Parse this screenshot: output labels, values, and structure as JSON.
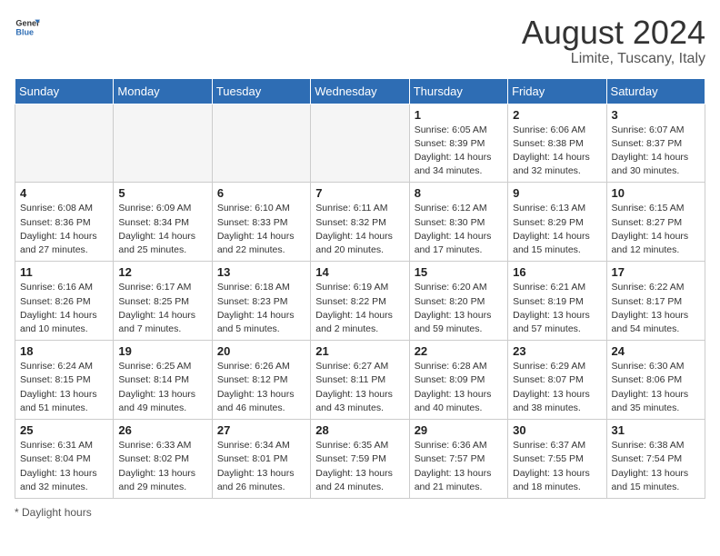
{
  "header": {
    "logo_general": "General",
    "logo_blue": "Blue",
    "main_title": "August 2024",
    "subtitle": "Limite, Tuscany, Italy"
  },
  "weekdays": [
    "Sunday",
    "Monday",
    "Tuesday",
    "Wednesday",
    "Thursday",
    "Friday",
    "Saturday"
  ],
  "weeks": [
    [
      {
        "day": "",
        "info": ""
      },
      {
        "day": "",
        "info": ""
      },
      {
        "day": "",
        "info": ""
      },
      {
        "day": "",
        "info": ""
      },
      {
        "day": "1",
        "info": "Sunrise: 6:05 AM\nSunset: 8:39 PM\nDaylight: 14 hours and 34 minutes."
      },
      {
        "day": "2",
        "info": "Sunrise: 6:06 AM\nSunset: 8:38 PM\nDaylight: 14 hours and 32 minutes."
      },
      {
        "day": "3",
        "info": "Sunrise: 6:07 AM\nSunset: 8:37 PM\nDaylight: 14 hours and 30 minutes."
      }
    ],
    [
      {
        "day": "4",
        "info": "Sunrise: 6:08 AM\nSunset: 8:36 PM\nDaylight: 14 hours and 27 minutes."
      },
      {
        "day": "5",
        "info": "Sunrise: 6:09 AM\nSunset: 8:34 PM\nDaylight: 14 hours and 25 minutes."
      },
      {
        "day": "6",
        "info": "Sunrise: 6:10 AM\nSunset: 8:33 PM\nDaylight: 14 hours and 22 minutes."
      },
      {
        "day": "7",
        "info": "Sunrise: 6:11 AM\nSunset: 8:32 PM\nDaylight: 14 hours and 20 minutes."
      },
      {
        "day": "8",
        "info": "Sunrise: 6:12 AM\nSunset: 8:30 PM\nDaylight: 14 hours and 17 minutes."
      },
      {
        "day": "9",
        "info": "Sunrise: 6:13 AM\nSunset: 8:29 PM\nDaylight: 14 hours and 15 minutes."
      },
      {
        "day": "10",
        "info": "Sunrise: 6:15 AM\nSunset: 8:27 PM\nDaylight: 14 hours and 12 minutes."
      }
    ],
    [
      {
        "day": "11",
        "info": "Sunrise: 6:16 AM\nSunset: 8:26 PM\nDaylight: 14 hours and 10 minutes."
      },
      {
        "day": "12",
        "info": "Sunrise: 6:17 AM\nSunset: 8:25 PM\nDaylight: 14 hours and 7 minutes."
      },
      {
        "day": "13",
        "info": "Sunrise: 6:18 AM\nSunset: 8:23 PM\nDaylight: 14 hours and 5 minutes."
      },
      {
        "day": "14",
        "info": "Sunrise: 6:19 AM\nSunset: 8:22 PM\nDaylight: 14 hours and 2 minutes."
      },
      {
        "day": "15",
        "info": "Sunrise: 6:20 AM\nSunset: 8:20 PM\nDaylight: 13 hours and 59 minutes."
      },
      {
        "day": "16",
        "info": "Sunrise: 6:21 AM\nSunset: 8:19 PM\nDaylight: 13 hours and 57 minutes."
      },
      {
        "day": "17",
        "info": "Sunrise: 6:22 AM\nSunset: 8:17 PM\nDaylight: 13 hours and 54 minutes."
      }
    ],
    [
      {
        "day": "18",
        "info": "Sunrise: 6:24 AM\nSunset: 8:15 PM\nDaylight: 13 hours and 51 minutes."
      },
      {
        "day": "19",
        "info": "Sunrise: 6:25 AM\nSunset: 8:14 PM\nDaylight: 13 hours and 49 minutes."
      },
      {
        "day": "20",
        "info": "Sunrise: 6:26 AM\nSunset: 8:12 PM\nDaylight: 13 hours and 46 minutes."
      },
      {
        "day": "21",
        "info": "Sunrise: 6:27 AM\nSunset: 8:11 PM\nDaylight: 13 hours and 43 minutes."
      },
      {
        "day": "22",
        "info": "Sunrise: 6:28 AM\nSunset: 8:09 PM\nDaylight: 13 hours and 40 minutes."
      },
      {
        "day": "23",
        "info": "Sunrise: 6:29 AM\nSunset: 8:07 PM\nDaylight: 13 hours and 38 minutes."
      },
      {
        "day": "24",
        "info": "Sunrise: 6:30 AM\nSunset: 8:06 PM\nDaylight: 13 hours and 35 minutes."
      }
    ],
    [
      {
        "day": "25",
        "info": "Sunrise: 6:31 AM\nSunset: 8:04 PM\nDaylight: 13 hours and 32 minutes."
      },
      {
        "day": "26",
        "info": "Sunrise: 6:33 AM\nSunset: 8:02 PM\nDaylight: 13 hours and 29 minutes."
      },
      {
        "day": "27",
        "info": "Sunrise: 6:34 AM\nSunset: 8:01 PM\nDaylight: 13 hours and 26 minutes."
      },
      {
        "day": "28",
        "info": "Sunrise: 6:35 AM\nSunset: 7:59 PM\nDaylight: 13 hours and 24 minutes."
      },
      {
        "day": "29",
        "info": "Sunrise: 6:36 AM\nSunset: 7:57 PM\nDaylight: 13 hours and 21 minutes."
      },
      {
        "day": "30",
        "info": "Sunrise: 6:37 AM\nSunset: 7:55 PM\nDaylight: 13 hours and 18 minutes."
      },
      {
        "day": "31",
        "info": "Sunrise: 6:38 AM\nSunset: 7:54 PM\nDaylight: 13 hours and 15 minutes."
      }
    ]
  ],
  "footer": {
    "note": "Daylight hours"
  }
}
